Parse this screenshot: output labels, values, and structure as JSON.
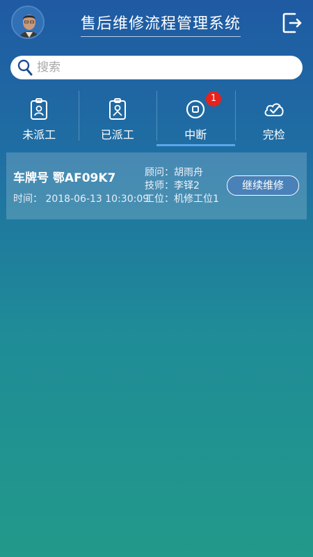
{
  "header": {
    "title": "售后维修流程管理系统",
    "avatar_icon": "user-avatar",
    "logout_icon": "logout-icon"
  },
  "search": {
    "placeholder": "搜索",
    "value": ""
  },
  "tabs": [
    {
      "label": "未派工",
      "icon": "badge-person-icon",
      "active": false
    },
    {
      "label": "已派工",
      "icon": "badge-person-icon",
      "active": false
    },
    {
      "label": "中断",
      "icon": "pause-circle-icon",
      "active": true,
      "badge": "1"
    },
    {
      "label": "完检",
      "icon": "cloud-check-icon",
      "active": false
    }
  ],
  "orders": [
    {
      "plate": "车牌号 鄂AF09K7",
      "time": "时间：  2018-06-13 10:30:09",
      "advisor": "顾问：胡雨舟",
      "technician": "技师：李铎2",
      "station": "工位：机修工位1",
      "action_label": "继续维修"
    }
  ],
  "colors": {
    "accent": "#5aa7ea",
    "badge": "#e8211c",
    "background_top": "#1f5aa3",
    "background_bottom": "#22998a"
  }
}
